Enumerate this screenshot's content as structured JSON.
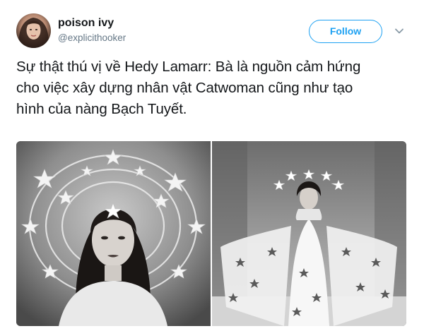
{
  "author": {
    "display_name": "poison ivy",
    "handle": "@explicithooker",
    "avatar_icon": "user-avatar"
  },
  "follow": {
    "label": "Follow",
    "accent_color": "#1da1f2"
  },
  "menu": {
    "icon": "chevron-down-icon"
  },
  "tweet": {
    "lines": [
      "Sự thật thú vị về Hedy Lamarr: Bà là nguồn cảm hứng",
      "cho việc xây dựng nhân vật Catwoman cũng như tạo",
      "hình của nàng Bạch Tuyết."
    ]
  },
  "media": {
    "photos": [
      "photo-portrait-star-headdress",
      "photo-full-length-star-gown"
    ]
  }
}
